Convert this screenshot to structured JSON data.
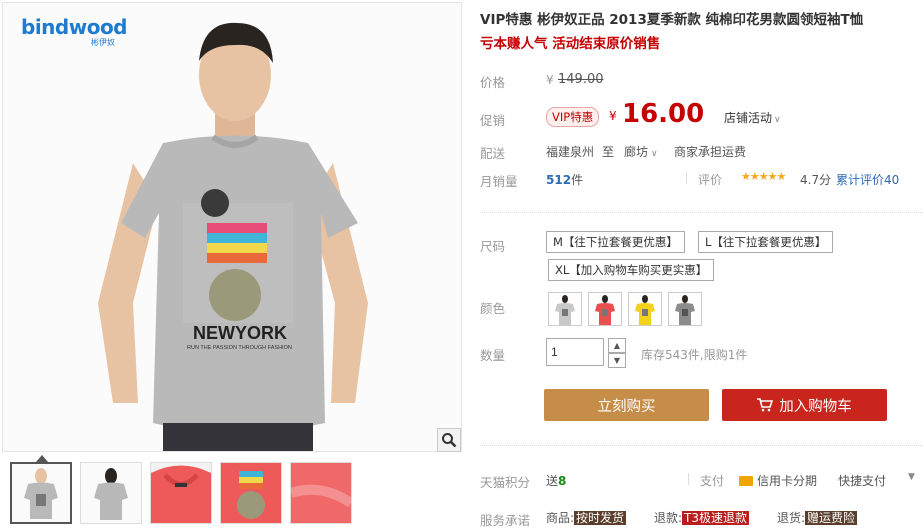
{
  "brand": {
    "name": "bindwood",
    "sub": "彬伊奴"
  },
  "main_image": {
    "print_text": "NEWYORK",
    "print_subtext": "RUN THE PASSION THROUGH FASHION",
    "icon": "zoom-icon"
  },
  "product": {
    "title": "VIP特惠 彬伊奴正品 2013夏季新款 纯棉印花男款圆领短袖T恤",
    "subtitle": "亏本赚人气 活动结束原价销售"
  },
  "price": {
    "label": "价格",
    "currency": "¥",
    "original": "149.00"
  },
  "promo": {
    "label": "促销",
    "tag": "VIP特惠",
    "currency": "¥",
    "value": "16.00",
    "store_activity": "店铺活动"
  },
  "shipping": {
    "label": "配送",
    "from": "福建泉州",
    "to_word": "至",
    "to": "廊坊",
    "fee": "商家承担运费"
  },
  "sales": {
    "label": "月销量",
    "count": "512",
    "unit": "件",
    "rating_label": "评价",
    "rating": "4.7分",
    "reviews": "累计评价40"
  },
  "size": {
    "label": "尺码",
    "options": [
      "M【往下拉套餐更优惠】",
      "L【往下拉套餐更优惠】",
      "XL【加入购物车购买更实惠】"
    ]
  },
  "color": {
    "label": "颜色",
    "swatch_colors": [
      "#c8c8c8",
      "#e85050",
      "#f2d21c",
      "#8c8c8c"
    ]
  },
  "quantity": {
    "label": "数量",
    "value": "1",
    "stock": "库存543件,限购1件"
  },
  "actions": {
    "buy": "立刻购买",
    "cart": "加入购物车"
  },
  "points": {
    "label": "天猫积分",
    "send": "送",
    "amount": "8",
    "pay_label": "支付",
    "credit": "信用卡分期",
    "quick": "快捷支付"
  },
  "service": {
    "label": "服务承诺",
    "goods_label": "商品:",
    "goods": "按时发货",
    "refund_label": "退款:",
    "refund": "T3极速退款",
    "return_label": "退货:",
    "return": "赠运费险"
  },
  "colors": {
    "accent_red": "#c40000",
    "buy_btn": "#c68d48",
    "cart_btn": "#c9251d"
  }
}
